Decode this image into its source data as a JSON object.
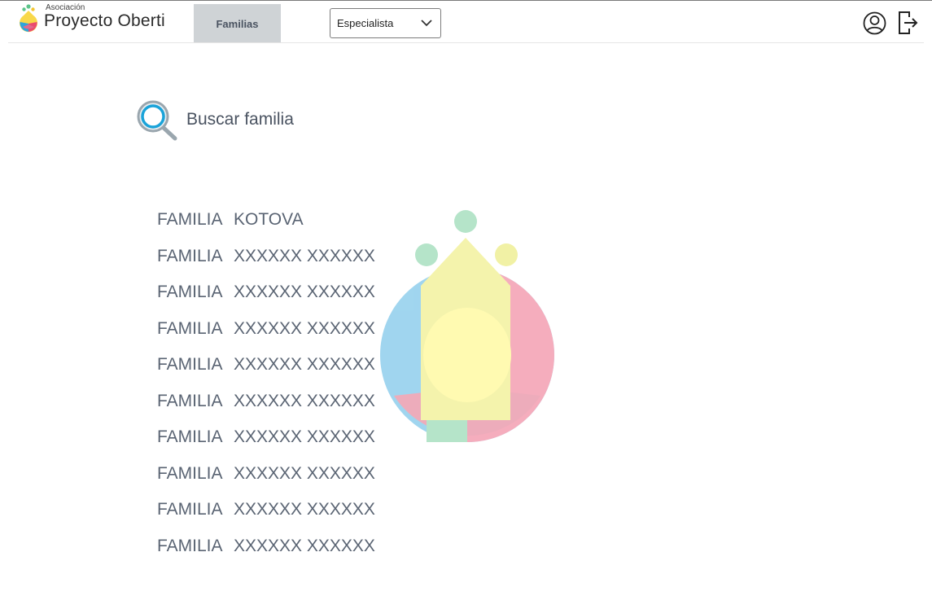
{
  "header": {
    "logo_small": "Asociación",
    "logo_big": "Proyecto Oberti",
    "tab_label": "Familias",
    "role_selected": "Especialista",
    "user_icon": "user-circle-icon",
    "logout_icon": "logout-icon"
  },
  "search": {
    "label": "Buscar familia",
    "icon": "magnifier-icon"
  },
  "families": [
    {
      "prefix": "FAMILIA",
      "name": "KOTOVA"
    },
    {
      "prefix": "FAMILIA",
      "name": "XXXXXX XXXXXX"
    },
    {
      "prefix": "FAMILIA",
      "name": "XXXXXX XXXXXX"
    },
    {
      "prefix": "FAMILIA",
      "name": "XXXXXX XXXXXX"
    },
    {
      "prefix": "FAMILIA",
      "name": "XXXXXX XXXXXX"
    },
    {
      "prefix": "FAMILIA",
      "name": "XXXXXX XXXXXX"
    },
    {
      "prefix": "FAMILIA",
      "name": "XXXXXX XXXXXX"
    },
    {
      "prefix": "FAMILIA",
      "name": "XXXXXX XXXXXX"
    },
    {
      "prefix": "FAMILIA",
      "name": "XXXXXX XXXXXX"
    },
    {
      "prefix": "FAMILIA",
      "name": "XXXXXX XXXXXX"
    }
  ],
  "colors": {
    "accent": "#1aa3d9",
    "tab_bg": "#cfd3d6",
    "text": "#5a6473"
  }
}
